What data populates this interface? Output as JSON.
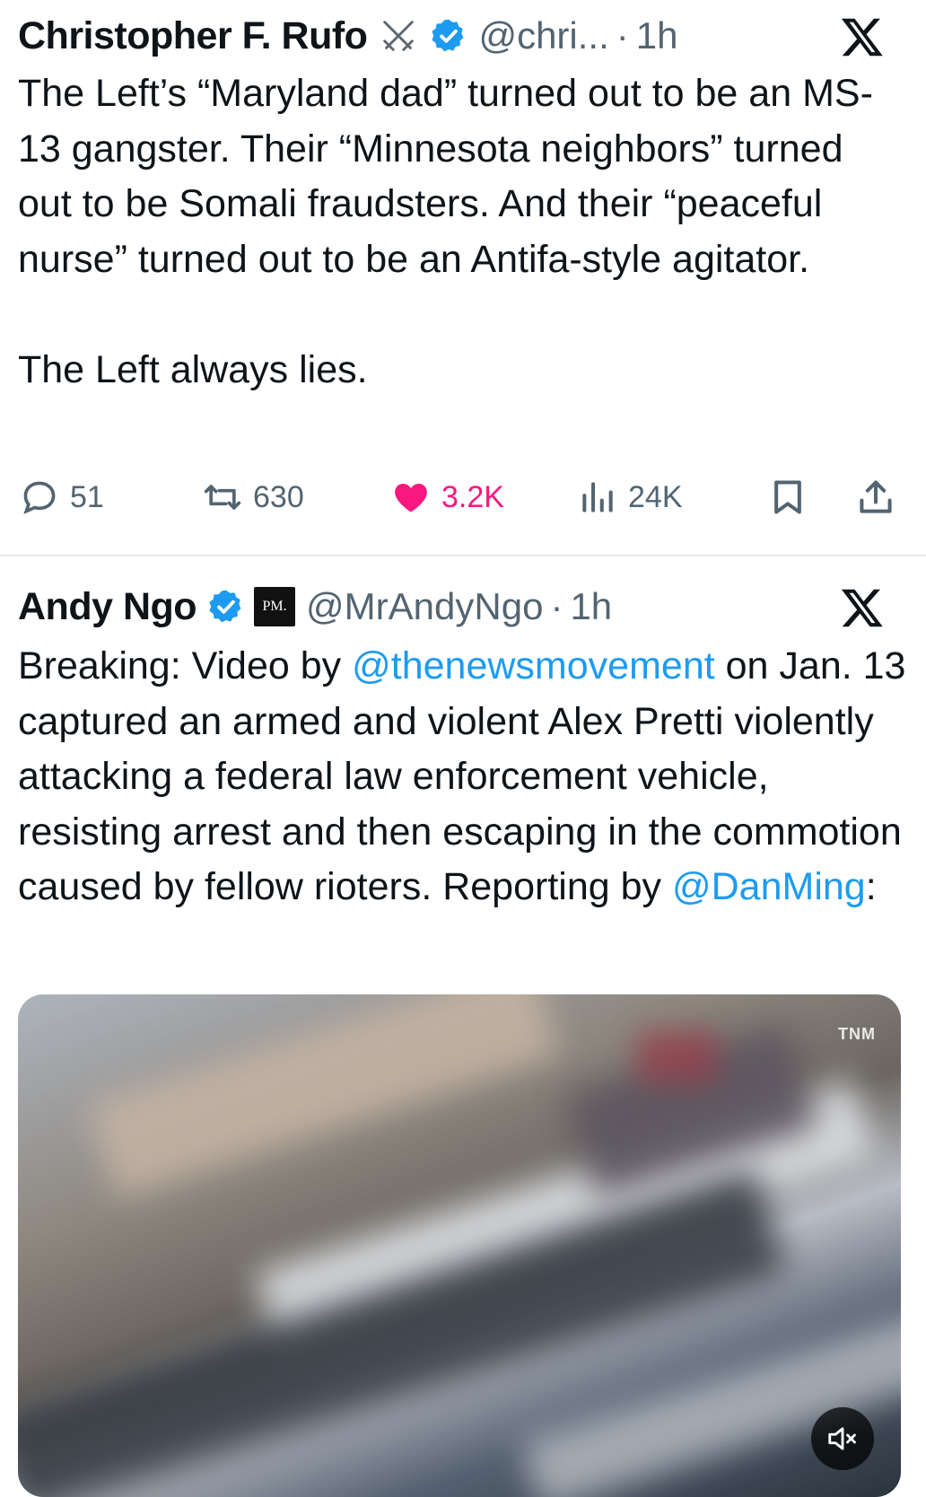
{
  "tweets": [
    {
      "author_name": "Christopher F. Rufo",
      "handle": "@chri...",
      "separator": "·",
      "time": "1h",
      "body": [
        "The Left’s “Maryland dad” turned out to be an MS-13 gangster. Their “Minnesota neighbors” turned out to be Somali fraudsters. And their “peaceful nurse” turned out to be an Antifa-style agitator.",
        "The Left always lies."
      ],
      "actions": {
        "replies": "51",
        "reposts": "630",
        "likes": "3.2K",
        "views": "24K"
      }
    },
    {
      "author_name": "Andy Ngo",
      "badge_text": "PM.",
      "handle": "@MrAndyNgo",
      "separator": "·",
      "time": "1h",
      "body_segments": {
        "s1": "Breaking: Video by ",
        "m1": "@thenewsmovement",
        "s2": " on Jan. 13 captured an armed and violent Alex Pretti violently attacking a federal law enforcement vehicle, resisting arrest and then escaping in the commotion caused by fellow rioters. Reporting by ",
        "m2": "@DanMing",
        "s3": ":"
      },
      "media": {
        "watermark": "TNM"
      }
    }
  ],
  "colors": {
    "verified": "#1d9bf0",
    "like": "#f91880",
    "link": "#1d9bf0",
    "secondary_text": "#536471"
  },
  "icons": [
    "swords-icon",
    "verified-badge-icon",
    "x-logo-icon",
    "reply-icon",
    "repost-icon",
    "like-icon",
    "views-icon",
    "bookmark-icon",
    "share-icon",
    "mute-icon"
  ]
}
